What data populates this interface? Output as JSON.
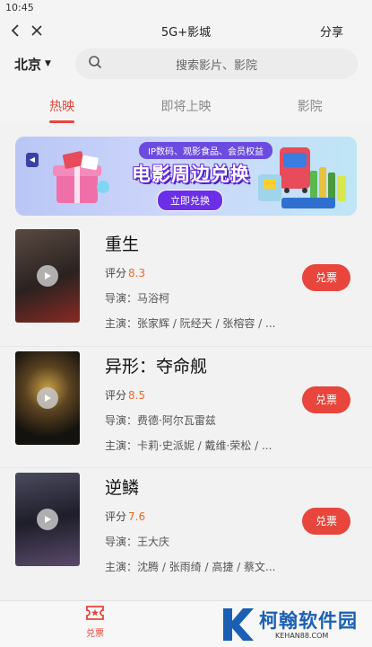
{
  "status_bar": {
    "time": "10:45"
  },
  "titlebar": {
    "title": "5G+影城",
    "share": "分享"
  },
  "location": {
    "city": "北京"
  },
  "search": {
    "placeholder": "搜索影片、影院"
  },
  "tabs": [
    {
      "label": "热映",
      "active": true
    },
    {
      "label": "即将上映",
      "active": false
    },
    {
      "label": "影院",
      "active": false
    }
  ],
  "banner": {
    "subtitle": "IP数码、观影食品、会员权益",
    "headline": "电影周边兑换",
    "cta": "立即兑换"
  },
  "movies": [
    {
      "title": "重生",
      "rating_label": "评分",
      "score": "8.3",
      "director": "导演：马浴柯",
      "cast": "主演：张家辉 / 阮经天 / 张榕容 / ...",
      "button": "兑票",
      "poster_colors": [
        "#3a3230",
        "#7a2a24"
      ]
    },
    {
      "title": "异形：夺命舰",
      "rating_label": "评分",
      "score": "8.5",
      "director": "导演：费德·阿尔瓦雷兹",
      "cast": "主演：卡莉·史派妮 / 戴维·荣松 / ...",
      "button": "兑票",
      "poster_colors": [
        "#1d1a14",
        "#b8902a"
      ]
    },
    {
      "title": "逆鳞",
      "rating_label": "评分",
      "score": "7.6",
      "director": "导演：王大庆",
      "cast": "主演：沈腾 / 张雨绮 / 高捷 / 蔡文...",
      "button": "兑票",
      "poster_colors": [
        "#2a2a3a",
        "#6a5a7a"
      ]
    }
  ],
  "bottom_nav": {
    "label": "兑票"
  },
  "watermark": {
    "text": "柯翰软件园",
    "url": "KEHAN88.COM"
  },
  "colors": {
    "accent": "#e8453c",
    "score": "#f06b2b"
  }
}
